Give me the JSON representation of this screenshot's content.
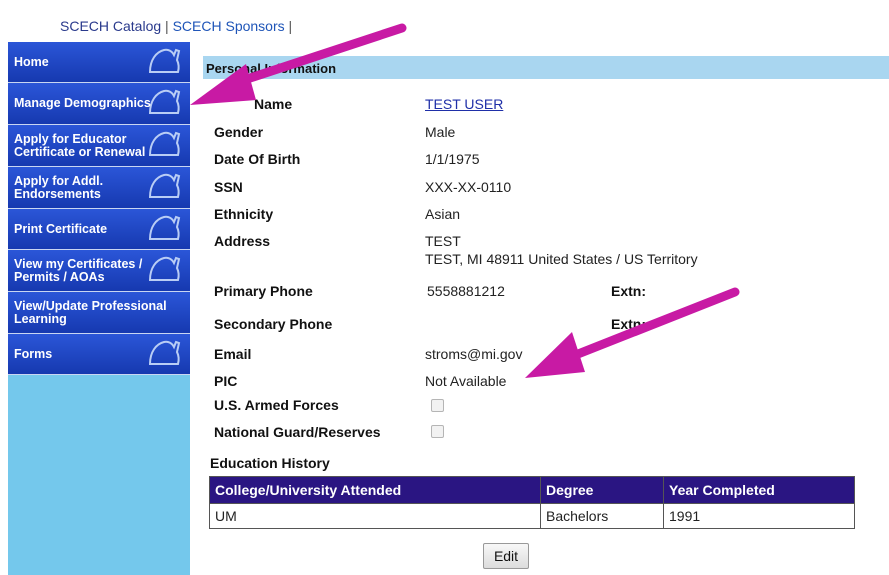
{
  "topnav": {
    "catalog": "SCECH Catalog",
    "sep1": " | ",
    "sponsors": "SCECH Sponsors",
    "sep2": " |"
  },
  "sidebar": {
    "items": [
      {
        "label": "Home"
      },
      {
        "label": "Manage Demographics"
      },
      {
        "label": "Apply for Educator Certificate or Renewal"
      },
      {
        "label": "Apply for Addl. Endorsements"
      },
      {
        "label": "Print Certificate"
      },
      {
        "label": "View my Certificates / Permits / AOAs"
      },
      {
        "label": "View/Update Professional Learning"
      },
      {
        "label": "Forms"
      }
    ]
  },
  "section": {
    "title": "Personal Information"
  },
  "fields": {
    "name_label": "Name",
    "name_value": "TEST USER",
    "gender_label": "Gender",
    "gender_value": "Male",
    "dob_label": "Date Of Birth",
    "dob_value": "1/1/1975",
    "ssn_label": "SSN",
    "ssn_value": "XXX-XX-0110",
    "ethnicity_label": "Ethnicity",
    "ethnicity_value": "Asian",
    "address_label": "Address",
    "address_line1": "TEST",
    "address_line2": "TEST, MI 48911 United States / US Territory",
    "primary_phone_label": "Primary Phone",
    "primary_phone_value": "5558881212",
    "primary_extn_label": "Extn:",
    "secondary_phone_label": "Secondary Phone",
    "secondary_extn_label": "Extn:",
    "email_label": "Email",
    "email_value": "stroms@mi.gov",
    "pic_label": "PIC",
    "pic_value": "Not Available",
    "armed_forces_label": "U.S. Armed Forces",
    "national_guard_label": "National Guard/Reserves"
  },
  "education": {
    "title": "Education History",
    "columns": [
      "College/University Attended",
      "Degree",
      "Year Completed"
    ],
    "rows": [
      [
        "UM",
        "Bachelors",
        "1991"
      ]
    ]
  },
  "buttons": {
    "edit": "Edit"
  },
  "colors": {
    "nav_blue": "#1f48c8",
    "sidebar_bg": "#74c8ec",
    "header_band": "#a9d6f0",
    "table_header": "#2a1582",
    "arrow": "#c81aa4"
  },
  "icons": [
    "hand-icon",
    "arrow-annotation"
  ]
}
